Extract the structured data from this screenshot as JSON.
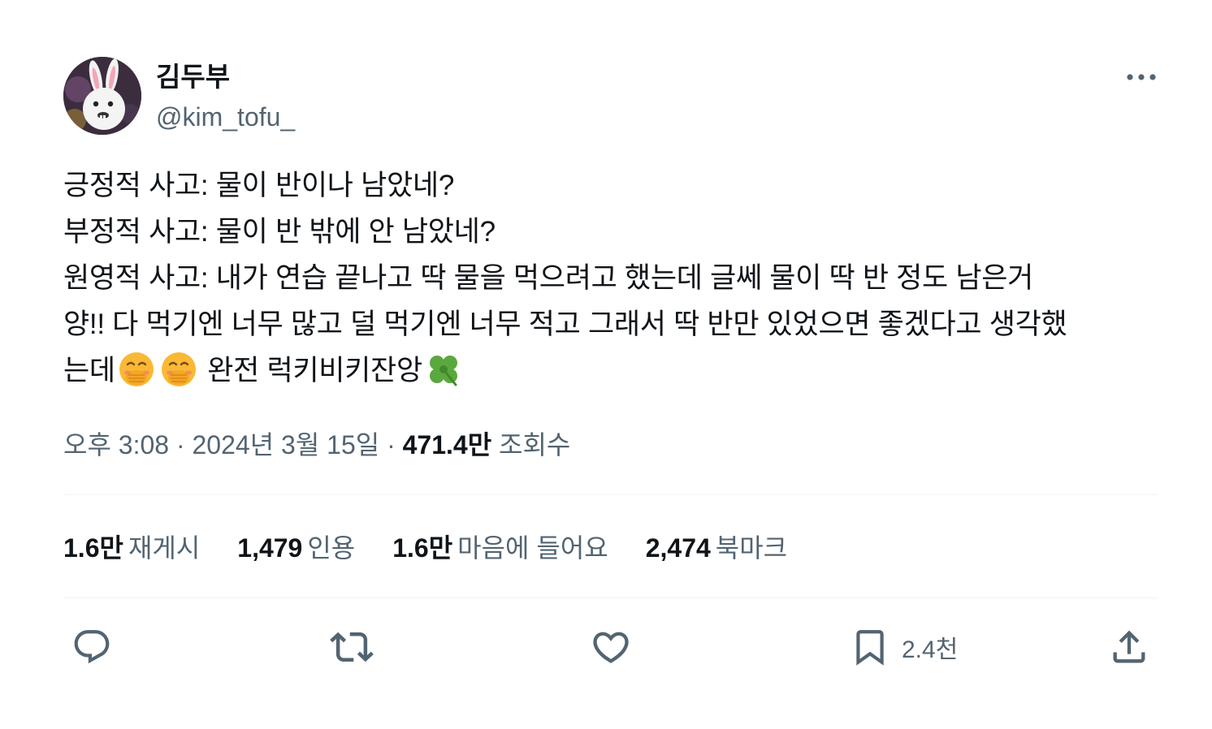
{
  "user": {
    "display_name": "김두부",
    "handle": "@kim_tofu_"
  },
  "tweet": {
    "lines": [
      "긍정적 사고: 물이 반이나 남았네?",
      "부정적 사고: 물이 반 밖에 안 남았네?",
      "원영적 사고: 내가 연습 끝나고 딱 물을 먹으려고 했는데 글쎄 물이 딱 반 정도 남은거",
      "양!! 다 먹기엔 너무 많고 덜 먹기엔 너무 적고 그래서 딱 반만 있었으면 좋겠다고 생각했"
    ],
    "last_line_start": "는데",
    "last_line_end": " 완전 럭키비키잔앙"
  },
  "meta": {
    "time": "오후 3:08",
    "sep": " · ",
    "date": "2024년 3월 15일",
    "views_count": "471.4만",
    "views_label": " 조회수"
  },
  "stats": {
    "reposts": {
      "count": "1.6만",
      "label": "재게시"
    },
    "quotes": {
      "count": "1,479",
      "label": "인용"
    },
    "likes": {
      "count": "1.6만",
      "label": "마음에 들어요"
    },
    "bookmarks": {
      "count": "2,474",
      "label": "북마크"
    }
  },
  "actions": {
    "bookmark_count": "2.4천"
  },
  "icons": [
    "more-icon",
    "reply-icon",
    "retweet-icon",
    "like-icon",
    "bookmark-icon",
    "share-icon",
    "face-hand-emoji-icon",
    "clover-emoji-icon"
  ],
  "colors": {
    "text": "#0f1419",
    "secondary": "#536471",
    "divider": "#eff3f4",
    "emoji_yellow": "#f9b934",
    "clover_green": "#5aa83e"
  }
}
